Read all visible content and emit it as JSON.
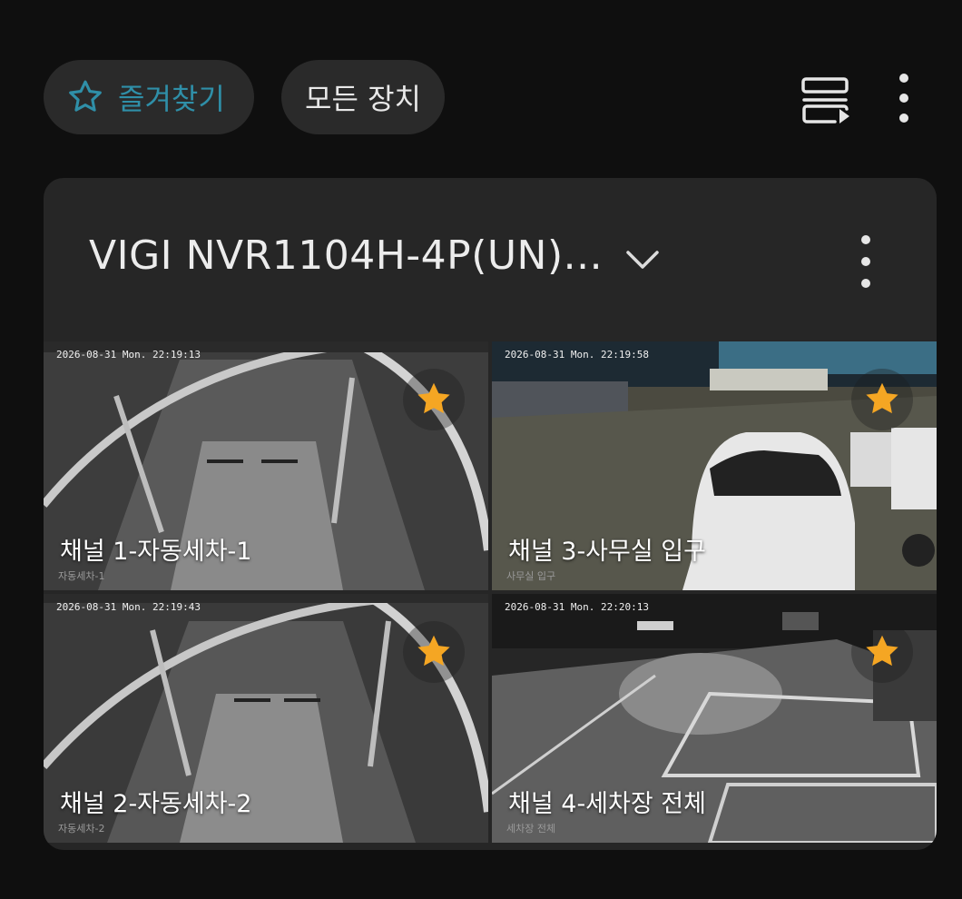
{
  "filters": {
    "favorites_label": "즐겨찾기",
    "all_devices_label": "모든 장치"
  },
  "device": {
    "title": "VIGI NVR1104H-4P(UN)..."
  },
  "colors": {
    "accent_teal": "#2f8fa8",
    "favorite_star": "#f5a623",
    "card_bg": "#262626",
    "chip_bg": "#2a2a2a"
  },
  "icons": {
    "favorites": "star-outline-icon",
    "playlist": "playlist-play-icon",
    "more": "more-vertical-icon",
    "expand": "chevron-down-icon",
    "favorite_badge": "star-filled-icon"
  },
  "channels": [
    {
      "label": "채널 1-자동세차-1",
      "timestamp": "2026-08-31 Mon. 22:19:13",
      "osd_name": "자동세차-1",
      "favorite": true
    },
    {
      "label": "채널 3-사무실 입구",
      "timestamp": "2026-08-31 Mon. 22:19:58",
      "osd_name": "사무실 입구",
      "favorite": true
    },
    {
      "label": "채널 2-자동세차-2",
      "timestamp": "2026-08-31 Mon. 22:19:43",
      "osd_name": "자동세차-2",
      "favorite": true
    },
    {
      "label": "채널 4-세차장 전체",
      "timestamp": "2026-08-31 Mon. 22:20:13",
      "osd_name": "세차장 전체",
      "favorite": true
    }
  ]
}
